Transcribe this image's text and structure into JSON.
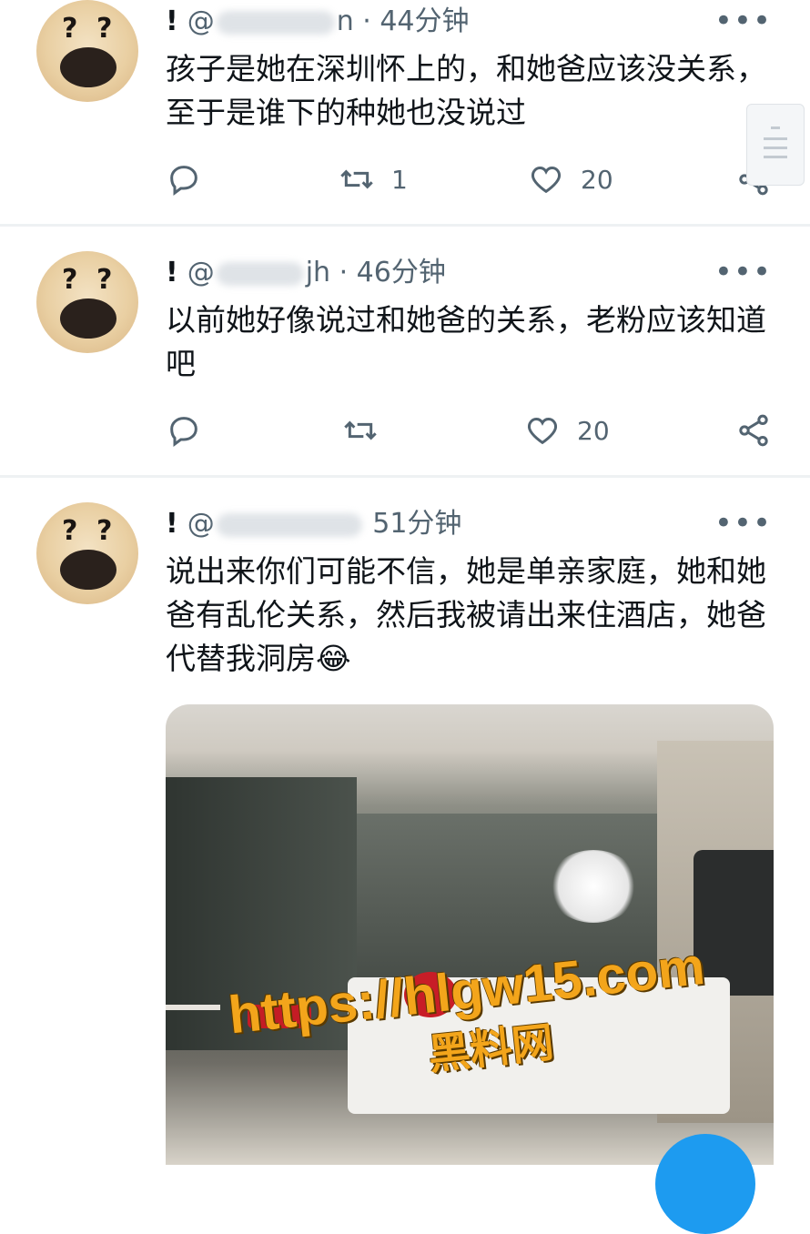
{
  "tweets": [
    {
      "name": "!",
      "handle_start": "@",
      "handle_end": "n",
      "time": "· 44分钟",
      "text": "孩子是她在深圳怀上的，和她爸应该没关系，至于是谁下的种她也没说过",
      "retweets": "1",
      "likes": "20"
    },
    {
      "name": "!",
      "handle_start": "@",
      "handle_end": "jh",
      "time": "· 46分钟",
      "text": "以前她好像说过和她爸的关系，老粉应该知道吧",
      "retweets": "",
      "likes": "20"
    },
    {
      "name": "!",
      "handle_start": "@",
      "handle_end": "",
      "time": "51分钟",
      "text": "说出来你们可能不信，她是单亲家庭，她和她爸有乱伦关系，然后我被请出来住酒店，她爸代替我洞房😂",
      "retweets": "",
      "likes": ""
    }
  ],
  "watermark": {
    "url": "https://hlgw15.com",
    "brand": "黑料网"
  },
  "icons": {
    "reply": "reply-icon",
    "retweet": "retweet-icon",
    "like": "heart-icon",
    "share": "share-icon",
    "more": "more-icon"
  },
  "colors": {
    "accent": "#1d9bf0",
    "muted": "#536471",
    "watermark": "#f3a51b"
  }
}
